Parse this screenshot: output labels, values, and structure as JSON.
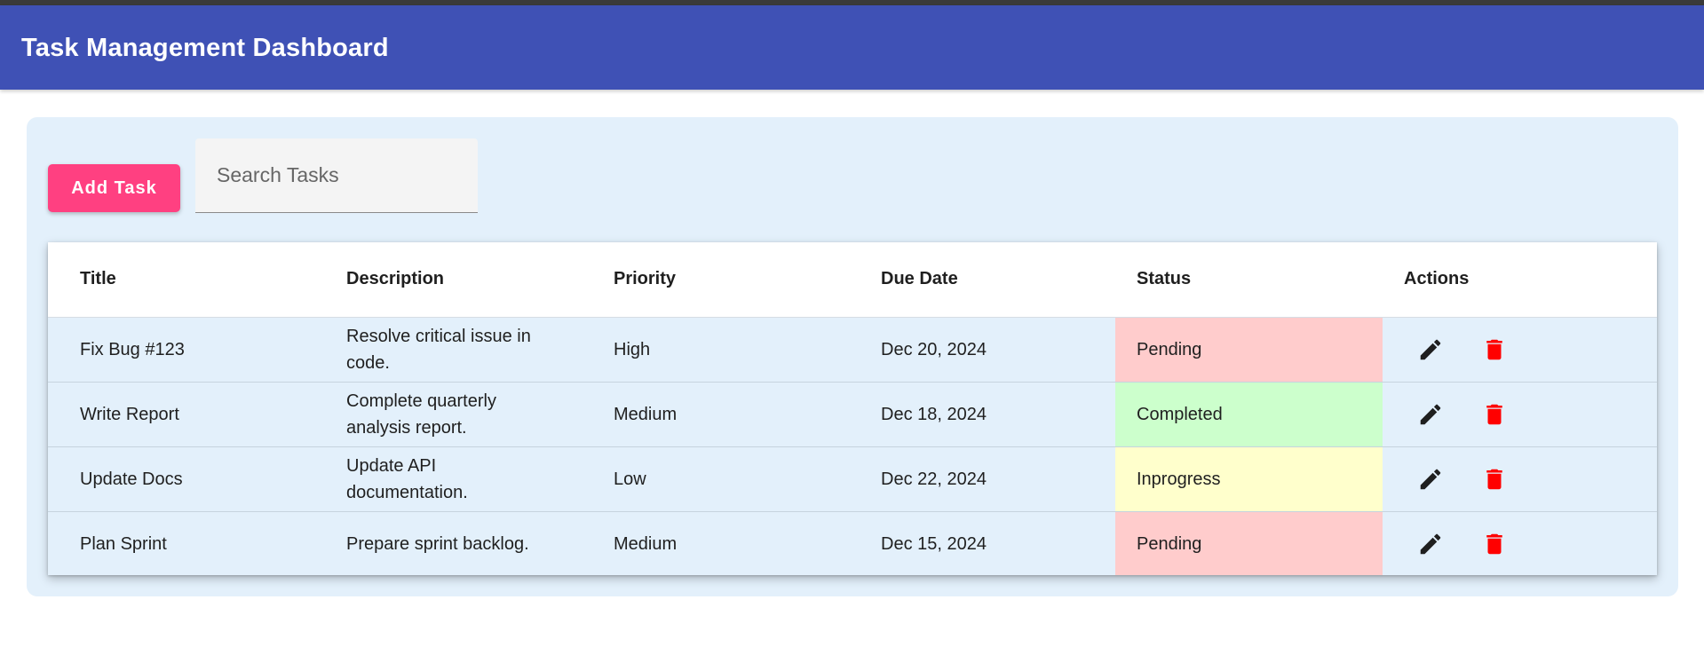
{
  "app": {
    "title": "Task Management Dashboard"
  },
  "toolbar": {
    "add_label": "Add Task",
    "search_placeholder": "Search Tasks",
    "search_value": ""
  },
  "table": {
    "headers": [
      "Title",
      "Description",
      "Priority",
      "Due Date",
      "Status",
      "Actions"
    ],
    "rows": [
      {
        "title": "Fix Bug #123",
        "description": "Resolve critical issue in code.",
        "priority": "High",
        "due_date": "Dec 20, 2024",
        "status": "Pending"
      },
      {
        "title": "Write Report",
        "description": "Complete quarterly analysis report.",
        "priority": "Medium",
        "due_date": "Dec 18, 2024",
        "status": "Completed"
      },
      {
        "title": "Update Docs",
        "description": "Update API documentation.",
        "priority": "Low",
        "due_date": "Dec 22, 2024",
        "status": "Inprogress"
      },
      {
        "title": "Plan Sprint",
        "description": "Prepare sprint backlog.",
        "priority": "Medium",
        "due_date": "Dec 15, 2024",
        "status": "Pending"
      }
    ]
  },
  "icons": {
    "edit": "edit-icon",
    "delete": "delete-icon"
  },
  "colors": {
    "appbar": "#3f51b5",
    "accent": "#ff4081",
    "panel": "#e3f0fb",
    "delete_icon": "#ff0000",
    "status_pending": "#ffcccc",
    "status_completed": "#ccffcc",
    "status_inprogress": "#ffffcc"
  }
}
